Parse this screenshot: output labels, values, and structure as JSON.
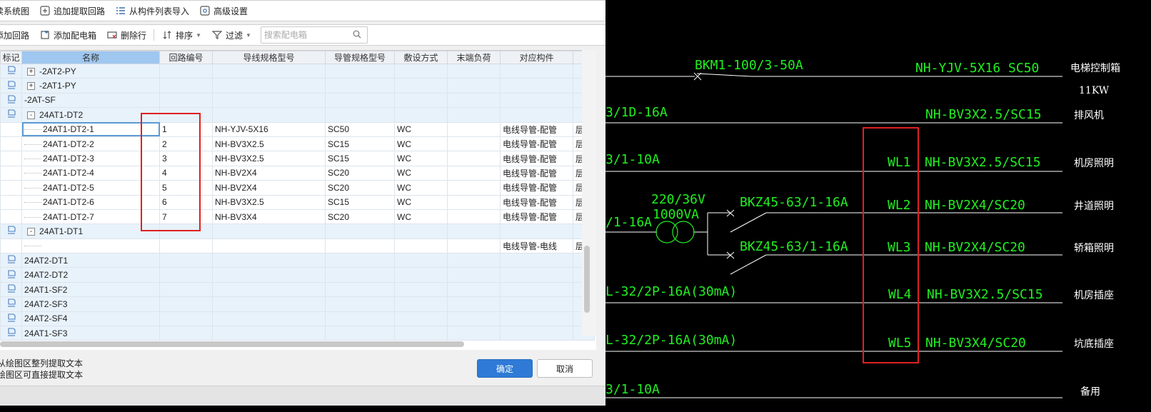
{
  "toolbar1": {
    "system_diagram": "读系统图",
    "add_extract": "追加提取回路",
    "import_from_list": "从构件列表导入",
    "advanced": "高级设置"
  },
  "toolbar2": {
    "add_circuit": "添加回路",
    "add_box": "添加配电箱",
    "delete_row": "删除行",
    "sort": "排序",
    "filter": "过滤",
    "search_placeholder": "搜索配电箱"
  },
  "table": {
    "columns": [
      "标记",
      "名称",
      "回路编号",
      "导线规格型号",
      "导管规格型号",
      "敷设方式",
      "末端负荷",
      "对应构件",
      ""
    ],
    "rows": [
      {
        "name": "-2AT2-PY",
        "circuit": "",
        "wire": "",
        "conduit": "",
        "method": "",
        "load": "",
        "component": "",
        "extra": ""
      },
      {
        "name": "-2AT1-PY",
        "circuit": "",
        "wire": "",
        "conduit": "",
        "method": "",
        "load": "",
        "component": "",
        "extra": ""
      },
      {
        "name": "-2AT-SF",
        "circuit": "",
        "wire": "",
        "conduit": "",
        "method": "",
        "load": "",
        "component": "",
        "extra": ""
      },
      {
        "name": "24AT1-DT2",
        "circuit": "",
        "wire": "",
        "conduit": "",
        "method": "",
        "load": "",
        "component": "",
        "extra": ""
      },
      {
        "name": "24AT1-DT2-1",
        "circuit": "1",
        "wire": "NH-YJV-5X16",
        "conduit": "SC50",
        "method": "WC",
        "load": "",
        "component": "电线导管-配管",
        "extra": "层"
      },
      {
        "name": "24AT1-DT2-2",
        "circuit": "2",
        "wire": "NH-BV3X2.5",
        "conduit": "SC15",
        "method": "WC",
        "load": "",
        "component": "电线导管-配管",
        "extra": "层"
      },
      {
        "name": "24AT1-DT2-3",
        "circuit": "3",
        "wire": "NH-BV3X2.5",
        "conduit": "SC15",
        "method": "WC",
        "load": "",
        "component": "电线导管-配管",
        "extra": "层"
      },
      {
        "name": "24AT1-DT2-4",
        "circuit": "4",
        "wire": "NH-BV2X4",
        "conduit": "SC20",
        "method": "WC",
        "load": "",
        "component": "电线导管-配管",
        "extra": "层"
      },
      {
        "name": "24AT1-DT2-5",
        "circuit": "5",
        "wire": "NH-BV2X4",
        "conduit": "SC20",
        "method": "WC",
        "load": "",
        "component": "电线导管-配管",
        "extra": "层"
      },
      {
        "name": "24AT1-DT2-6",
        "circuit": "6",
        "wire": "NH-BV3X2.5",
        "conduit": "SC15",
        "method": "WC",
        "load": "",
        "component": "电线导管-配管",
        "extra": "层"
      },
      {
        "name": "24AT1-DT2-7",
        "circuit": "7",
        "wire": "NH-BV3X4",
        "conduit": "SC20",
        "method": "WC",
        "load": "",
        "component": "电线导管-配管",
        "extra": "层"
      },
      {
        "name": "24AT1-DT1",
        "circuit": "",
        "wire": "",
        "conduit": "",
        "method": "",
        "load": "",
        "component": "",
        "extra": ""
      },
      {
        "name": "",
        "circuit": "",
        "wire": "",
        "conduit": "",
        "method": "",
        "load": "",
        "component": "电线导管-电线",
        "extra": "层"
      },
      {
        "name": "24AT2-DT1",
        "circuit": "",
        "wire": "",
        "conduit": "",
        "method": "",
        "load": "",
        "component": "",
        "extra": ""
      },
      {
        "name": "24AT2-DT2",
        "circuit": "",
        "wire": "",
        "conduit": "",
        "method": "",
        "load": "",
        "component": "",
        "extra": ""
      },
      {
        "name": "24AT1-SF2",
        "circuit": "",
        "wire": "",
        "conduit": "",
        "method": "",
        "load": "",
        "component": "",
        "extra": ""
      },
      {
        "name": "24AT2-SF3",
        "circuit": "",
        "wire": "",
        "conduit": "",
        "method": "",
        "load": "",
        "component": "",
        "extra": ""
      },
      {
        "name": "24AT2-SF4",
        "circuit": "",
        "wire": "",
        "conduit": "",
        "method": "",
        "load": "",
        "component": "",
        "extra": ""
      },
      {
        "name": "24AT1-SF3",
        "circuit": "",
        "wire": "",
        "conduit": "",
        "method": "",
        "load": "",
        "component": "",
        "extra": ""
      }
    ]
  },
  "footer": {
    "hint1": "从绘图区整列提取文本",
    "hint2": "绘图区可直接提取文本",
    "ok": "确定",
    "cancel": "取消"
  },
  "cad": {
    "breaker_top": "BKM1-100/3-50A",
    "cable_top": "NH-YJV-5X16 SC50",
    "label_top": "电梯控制箱",
    "power_top": "11KW",
    "frag1": "3/1D-16A",
    "cable2": "NH-BV3X2.5/SC15",
    "label2": "排风机",
    "frag2": "3/1-10A",
    "wl1": "WL1",
    "cable3": "NH-BV3X2.5/SC15",
    "label3": "机房照明",
    "transformer_v": "220/36V",
    "transformer_va": "1000VA",
    "bk1": "BKZ45-63/1-16A",
    "frag3": "/1-16A",
    "wl2": "WL2",
    "cable4": "NH-BV2X4/SC20",
    "label4": "井道照明",
    "bk2": "BKZ45-63/1-16A",
    "wl3": "WL3",
    "cable5": "NH-BV2X4/SC20",
    "label5": "轿箱照明",
    "frag4": "L-32/2P-16A(30mA)",
    "wl4": "WL4",
    "cable6": "NH-BV3X2.5/SC15",
    "label6": "机房插座",
    "frag5": "L-32/2P-16A(30mA)",
    "wl5": "WL5",
    "cable7": "NH-BV3X4/SC20",
    "label7": "坑底插座",
    "frag6": "3/1-10A",
    "label8": "备用"
  },
  "colors": {
    "accent": "#2e7ad6",
    "selected_column": "#9fc7f0",
    "row_blue": "#e8f2fb",
    "annotation_red": "#e02020",
    "cad_green": "#22ee22",
    "cad_background": "#000000"
  }
}
